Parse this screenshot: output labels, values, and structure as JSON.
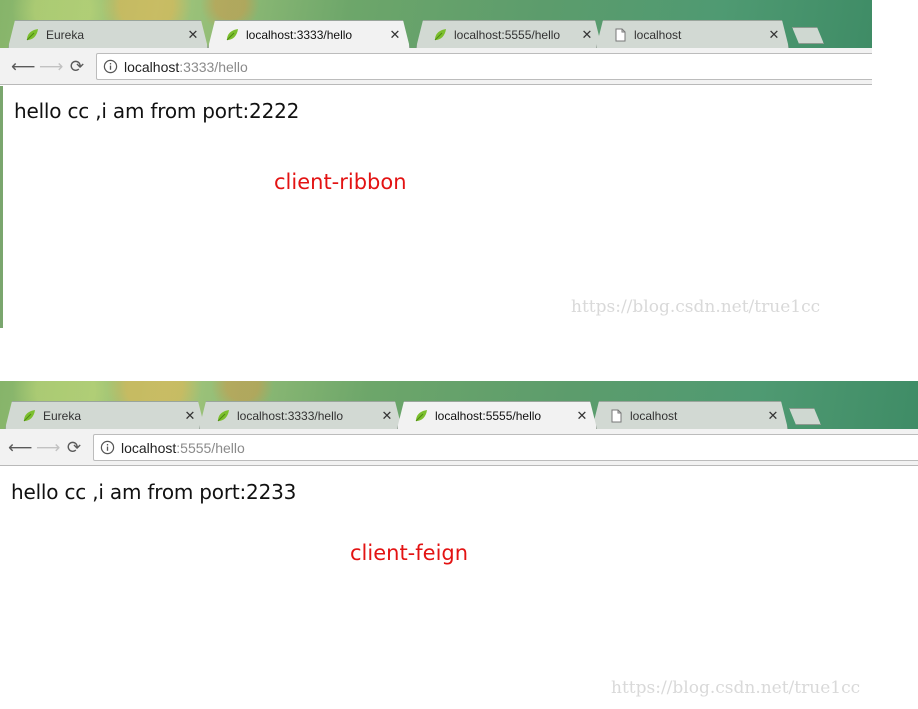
{
  "screens": [
    {
      "tabs": [
        {
          "label": "Eureka",
          "icon": "spring-leaf-icon",
          "active": false
        },
        {
          "label": "localhost:3333/hello",
          "icon": "spring-leaf-icon",
          "active": true
        },
        {
          "label": "localhost:5555/hello",
          "icon": "spring-leaf-icon",
          "active": false
        },
        {
          "label": "localhost",
          "icon": "page-icon",
          "active": false
        }
      ],
      "url": {
        "host": "localhost",
        "rest": ":3333/hello"
      },
      "body_text": "hello cc ,i am from port:2222",
      "annotation": "client-ribbon",
      "watermark": "https://blog.csdn.net/true1cc"
    },
    {
      "tabs": [
        {
          "label": "Eureka",
          "icon": "spring-leaf-icon",
          "active": false
        },
        {
          "label": "localhost:3333/hello",
          "icon": "spring-leaf-icon",
          "active": false
        },
        {
          "label": "localhost:5555/hello",
          "icon": "spring-leaf-icon",
          "active": true
        },
        {
          "label": "localhost",
          "icon": "page-icon",
          "active": false
        }
      ],
      "url": {
        "host": "localhost",
        "rest": ":5555/hello"
      },
      "body_text": "hello cc ,i am from port:2233",
      "annotation": "client-feign",
      "watermark": "https://blog.csdn.net/true1cc"
    }
  ],
  "colors": {
    "annotation": "#e31313",
    "url_rest": "#8a8a8a",
    "leaf": "#7cbf2e"
  }
}
